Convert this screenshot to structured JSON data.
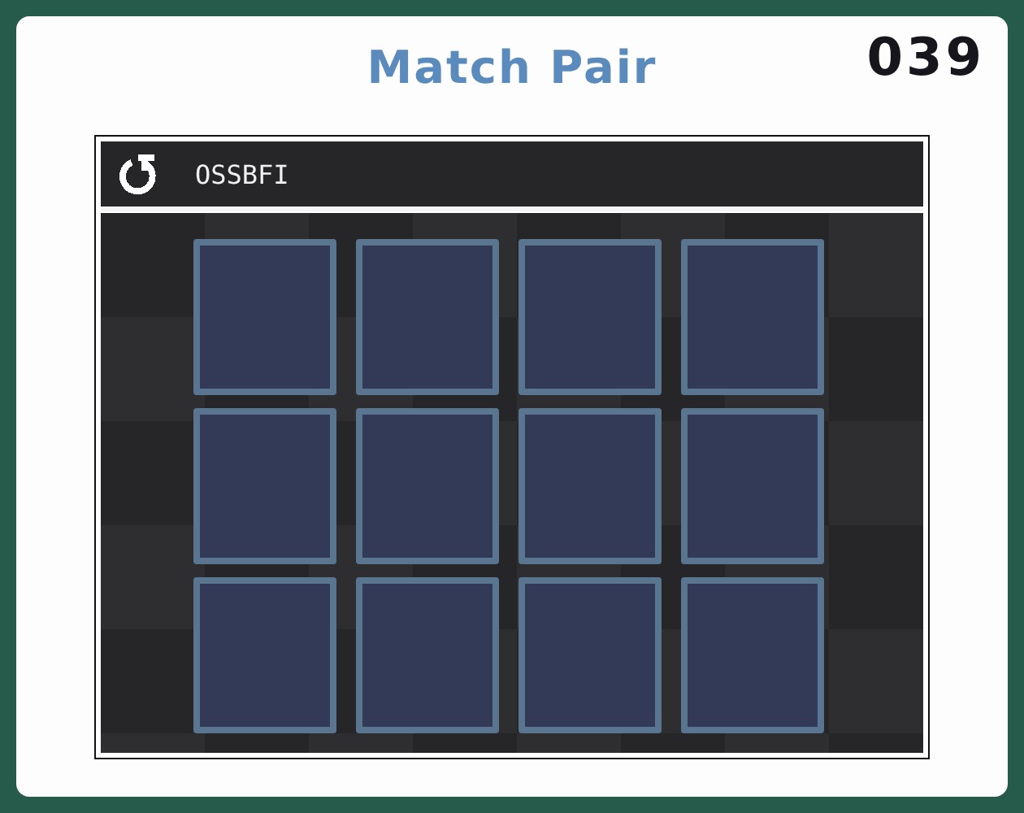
{
  "title": "Match Pair",
  "score": "039",
  "game": {
    "code": "OSSBFI",
    "cards": [
      {
        "kind": "hidden"
      },
      {
        "kind": "hidden"
      },
      {
        "kind": "hidden"
      },
      {
        "kind": "hidden"
      },
      {
        "kind": "hidden"
      },
      {
        "kind": "hidden"
      },
      {
        "kind": "hidden"
      },
      {
        "kind": "hidden"
      },
      {
        "kind": "hidden"
      },
      {
        "kind": "hidden"
      },
      {
        "kind": "hidden"
      },
      {
        "kind": "hidden"
      }
    ]
  }
}
